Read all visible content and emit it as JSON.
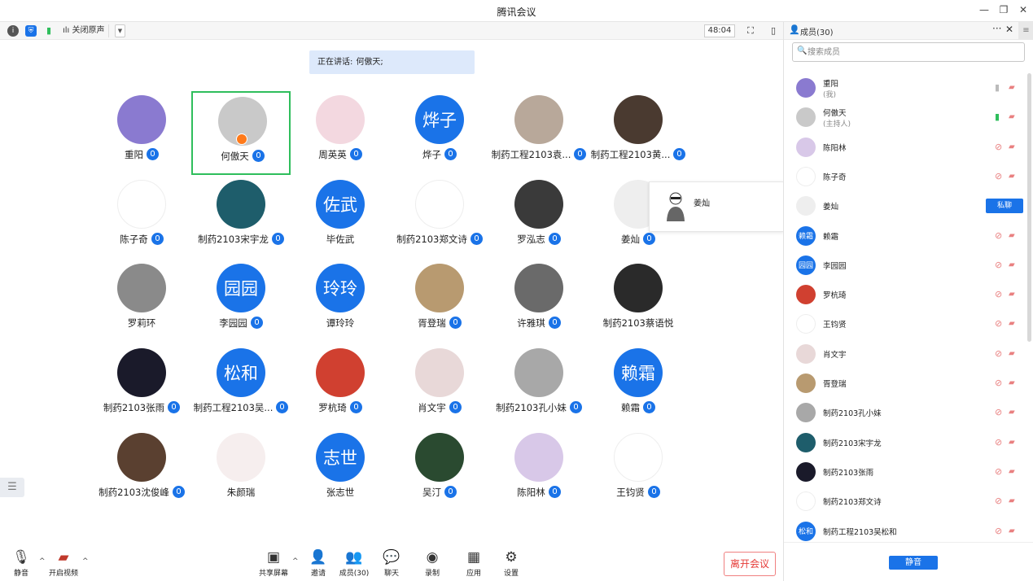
{
  "window": {
    "title": "腾讯会议",
    "minimize": "—",
    "restore": "❐",
    "close": "✕"
  },
  "toolbar": {
    "info_icon": "i",
    "shield_icon": "⛨",
    "signal_icon": "▮",
    "audio_label": "关闭原声",
    "dropdown": "▼",
    "timer": "48:04",
    "fullscreen": "⛶",
    "layout": "▯"
  },
  "speaking": {
    "label": "正在讲话:",
    "name": "何傲天;"
  },
  "tiles": [
    {
      "name": "重阳",
      "type": "img",
      "color": "#8a7ad0",
      "mic": true
    },
    {
      "name": "何傲天",
      "type": "img",
      "color": "#c9c9c9",
      "mic": true,
      "active": true,
      "host": true
    },
    {
      "name": "周英英",
      "type": "img",
      "color": "#f3d8e0",
      "mic": true
    },
    {
      "name": "烨子",
      "type": "blue",
      "label": "烨子",
      "mic": true
    },
    {
      "name": "制药工程2103袁...",
      "type": "img",
      "color": "#b8a89a",
      "mic": true
    },
    {
      "name": "制药工程2103黄...",
      "type": "img",
      "color": "#4a3a30",
      "mic": true
    },
    {
      "name": "陈子奇",
      "type": "img",
      "color": "#ffffff",
      "mic": true
    },
    {
      "name": "制药2103宋宇龙",
      "type": "img",
      "color": "#1e5d6b",
      "mic": true
    },
    {
      "name": "毕佐武",
      "type": "blue",
      "label": "佐武",
      "mic": false
    },
    {
      "name": "制药2103郑文诗",
      "type": "img",
      "color": "#ffffff",
      "mic": true
    },
    {
      "name": "罗泓志",
      "type": "img",
      "color": "#3a3a3a",
      "mic": true
    },
    {
      "name": "姜灿",
      "type": "img",
      "color": "#eeeeee",
      "mic": true
    },
    {
      "name": "罗莉环",
      "type": "img",
      "color": "#8a8a8a",
      "mic": false
    },
    {
      "name": "李园园",
      "type": "blue",
      "label": "园园",
      "mic": true
    },
    {
      "name": "谭玲玲",
      "type": "blue",
      "label": "玲玲",
      "mic": false
    },
    {
      "name": "胥登瑞",
      "type": "img",
      "color": "#b89a70",
      "mic": true
    },
    {
      "name": "许雅琪",
      "type": "img",
      "color": "#6a6a6a",
      "mic": true
    },
    {
      "name": "制药2103蔡语悦",
      "type": "img",
      "color": "#2a2a2a",
      "mic": false
    },
    {
      "name": "制药2103张雨",
      "type": "img",
      "color": "#1a1a2a",
      "mic": true
    },
    {
      "name": "制药工程2103吴...",
      "type": "blue",
      "label": "松和",
      "mic": true
    },
    {
      "name": "罗杭琦",
      "type": "img",
      "color": "#d04030",
      "mic": true
    },
    {
      "name": "肖文宇",
      "type": "img",
      "color": "#e8d8d8",
      "mic": true
    },
    {
      "name": "制药2103孔小妹",
      "type": "img",
      "color": "#a8a8a8",
      "mic": true
    },
    {
      "name": "赖霜",
      "type": "blue",
      "label": "赖霜",
      "mic": true
    },
    {
      "name": "制药2103沈俊峰",
      "type": "img",
      "color": "#5a4030",
      "mic": true
    },
    {
      "name": "朱颜瑞",
      "type": "img",
      "color": "#f6eeee",
      "mic": false
    },
    {
      "name": "张志世",
      "type": "blue",
      "label": "志世",
      "mic": false
    },
    {
      "name": "吴汀",
      "type": "img",
      "color": "#2a4a30",
      "mic": true
    },
    {
      "name": "陈阳林",
      "type": "img",
      "color": "#d8c8e8",
      "mic": true
    },
    {
      "name": "王钧贤",
      "type": "img",
      "color": "#ffffff",
      "mic": true
    }
  ],
  "tooltip": {
    "name": "姜灿"
  },
  "bottombar": {
    "mute": "静音",
    "video": "开启视频",
    "share": "共享屏幕",
    "invite": "邀请",
    "members": "成员(30)",
    "chat": "聊天",
    "record": "录制",
    "apps": "应用",
    "settings": "设置",
    "leave": "离开会议"
  },
  "panel": {
    "title": "成员(30)",
    "more": "···",
    "close": "✕",
    "search_placeholder": "搜索成员",
    "members": [
      {
        "name": "重阳",
        "sub": "(我)",
        "type": "img",
        "color": "#8a7ad0",
        "mic_state": "off-gray"
      },
      {
        "name": "何傲天",
        "sub": "(主持人)",
        "type": "img",
        "color": "#c9c9c9",
        "mic_state": "on"
      },
      {
        "name": "陈阳林",
        "type": "img",
        "color": "#d8c8e8"
      },
      {
        "name": "陈子奇",
        "type": "img",
        "color": "#ffffff"
      },
      {
        "name": "姜灿",
        "type": "img",
        "color": "#eeeeee",
        "private": "私聊"
      },
      {
        "name": "赖霜",
        "type": "blue",
        "label": "赖霜"
      },
      {
        "name": "李园园",
        "type": "blue",
        "label": "园园"
      },
      {
        "name": "罗杭琦",
        "type": "img",
        "color": "#d04030"
      },
      {
        "name": "王钧贤",
        "type": "img",
        "color": "#ffffff"
      },
      {
        "name": "肖文宇",
        "type": "img",
        "color": "#e8d8d8"
      },
      {
        "name": "胥登瑞",
        "type": "img",
        "color": "#b89a70"
      },
      {
        "name": "制药2103孔小妹",
        "type": "img",
        "color": "#a8a8a8"
      },
      {
        "name": "制药2103宋宇龙",
        "type": "img",
        "color": "#1e5d6b"
      },
      {
        "name": "制药2103张雨",
        "type": "img",
        "color": "#1a1a2a"
      },
      {
        "name": "制药2103郑文诗",
        "type": "img",
        "color": "#ffffff"
      },
      {
        "name": "制药工程2103吴松和",
        "type": "blue",
        "label": "松和"
      }
    ],
    "mute_all": "静音"
  },
  "colors": {
    "accent": "#1a73e8",
    "active_border": "#2fbe5c",
    "leave": "#e53935"
  }
}
